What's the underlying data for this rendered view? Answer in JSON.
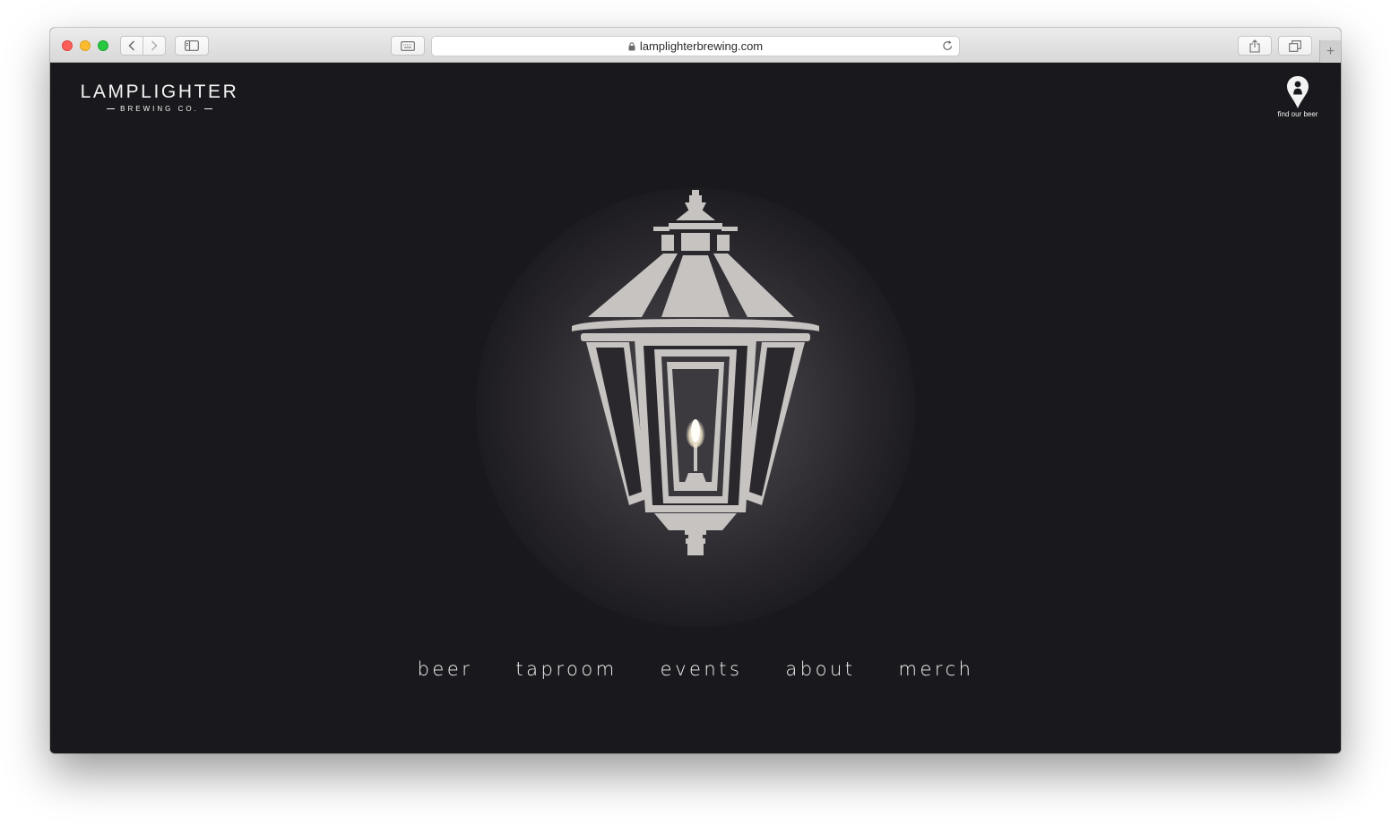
{
  "browser": {
    "url": "lamplighterbrewing.com",
    "new_tab_label": "+"
  },
  "site": {
    "logo": {
      "main": "LAMPLIGHTER",
      "sub": "BREWING CO."
    },
    "find": {
      "label": "find our beer",
      "icon": "location-pin-icon"
    },
    "menu": [
      "beer",
      "taproom",
      "events",
      "about",
      "merch"
    ]
  },
  "colors": {
    "background": "#19181c",
    "lantern": "#c6c3c1",
    "text": "#f3f3f3"
  }
}
